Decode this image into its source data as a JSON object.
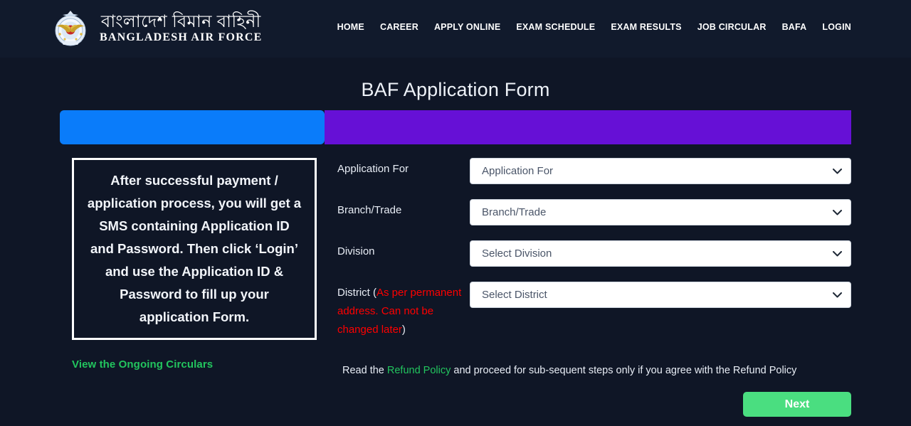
{
  "header": {
    "logo": {
      "icon": "baf-crest-icon",
      "title_bn": "বাংলাদেশ বিমান বাহিনী",
      "title_en": "BANGLADESH AIR FORCE"
    },
    "nav": [
      {
        "label": "HOME"
      },
      {
        "label": "CAREER"
      },
      {
        "label": "APPLY ONLINE"
      },
      {
        "label": "EXAM SCHEDULE"
      },
      {
        "label": "EXAM RESULTS"
      },
      {
        "label": "JOB CIRCULAR"
      },
      {
        "label": "BAFA"
      },
      {
        "label": "LOGIN"
      }
    ]
  },
  "page_title": "BAF Application Form",
  "progress": {
    "completed_percent": 33,
    "done_color": "#0a7cfa",
    "todo_color": "#6610d6"
  },
  "info_box": {
    "text": "After successful payment / application process, you will get a SMS containing Application ID and Password. Then click ‘Login’ and use the Application ID & Password to fill up your application Form."
  },
  "circulars_link": {
    "label": "View the Ongoing Circulars",
    "color": "#22c55e"
  },
  "form": {
    "rows": [
      {
        "label": "Application For",
        "note": "",
        "note_suffix": "",
        "selected": "Application For",
        "options": [
          "Application For"
        ]
      },
      {
        "label": "Branch/Trade",
        "note": "",
        "note_suffix": "",
        "selected": "Branch/Trade",
        "options": [
          "Branch/Trade"
        ]
      },
      {
        "label": "Division",
        "note": "",
        "note_suffix": "",
        "selected": "Select Division",
        "options": [
          "Select Division"
        ]
      },
      {
        "label": "District (",
        "note": "As per permanent address. Can not be changed later",
        "note_suffix": ")",
        "selected": "Select District",
        "options": [
          "Select District"
        ]
      }
    ]
  },
  "refund": {
    "prefix": "Read the ",
    "link": "Refund Policy",
    "suffix": " and proceed for sub-sequent steps only if you agree with the Refund Policy"
  },
  "next_button": {
    "label": "Next",
    "color": "#4ade80"
  }
}
